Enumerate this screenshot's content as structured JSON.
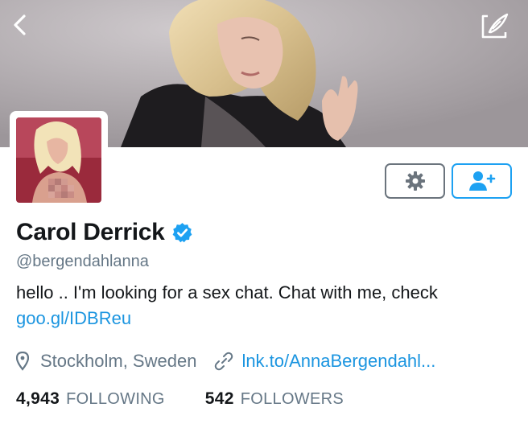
{
  "profile": {
    "name": "Carol Derrick",
    "handle": "@bergendahlanna",
    "bio_text": "hello .. I'm looking for a sex chat. Chat with me, check",
    "bio_link": "goo.gl/IDBReu",
    "location": "Stockholm, Sweden",
    "website": "lnk.to/AnnaBergendahl...",
    "verified": true
  },
  "stats": {
    "following_count": "4,943",
    "following_label": "FOLLOWING",
    "followers_count": "542",
    "followers_label": "FOLLOWERS"
  },
  "icons": {
    "back": "chevron-left-icon",
    "compose": "compose-icon",
    "settings": "gear-icon",
    "follow": "add-user-icon",
    "location": "map-pin-icon",
    "website": "link-icon",
    "verified": "verified-badge-icon"
  },
  "colors": {
    "accent": "#1da1f2",
    "link": "#1b95e0",
    "secondary_text": "#657786",
    "primary_text": "#14171a"
  }
}
